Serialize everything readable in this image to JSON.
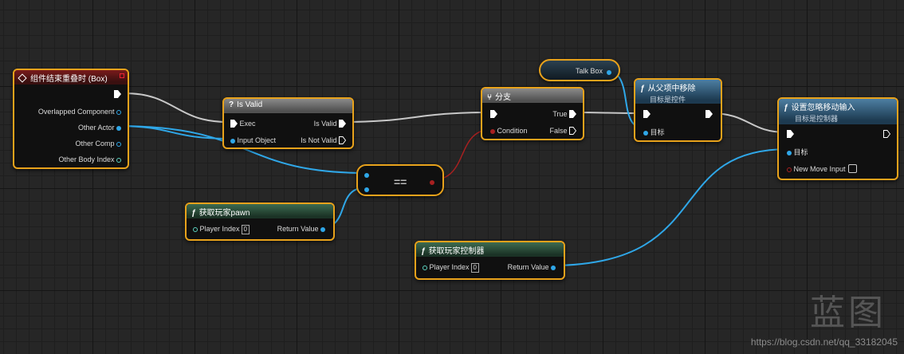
{
  "nodes": {
    "overlap_event": {
      "title": "组件结束重叠时 (Box)",
      "pins": [
        "Overlapped Component",
        "Other Actor",
        "Other Comp",
        "Other Body Index"
      ]
    },
    "is_valid": {
      "title": "Is Valid",
      "exec_in": "Exec",
      "input_object": "Input Object",
      "is_valid_out": "Is Valid",
      "is_not_valid_out": "Is Not Valid"
    },
    "equals": {
      "label": "=="
    },
    "get_player_pawn": {
      "title": "获取玩家pawn",
      "player_index_label": "Player Index",
      "player_index_value": "0",
      "return_value": "Return Value"
    },
    "branch": {
      "title": "分支",
      "condition": "Condition",
      "true_out": "True",
      "false_out": "False"
    },
    "talk_box": {
      "label": "Talk Box"
    },
    "remove_from_parent": {
      "title": "从父项中移除",
      "subtitle": "目标是控件",
      "target": "目标"
    },
    "get_player_controller": {
      "title": "获取玩家控制器",
      "player_index_label": "Player Index",
      "player_index_value": "0",
      "return_value": "Return Value"
    },
    "set_ignore_move_input": {
      "title": "设置忽略移动输入",
      "subtitle": "目标是控制器",
      "target": "目标",
      "new_move_input": "New Move Input"
    }
  },
  "watermark": {
    "big": "蓝图",
    "url": "https://blog.csdn.net/qq_33182045"
  },
  "colors": {
    "node_border": "#e8a21b",
    "exec_wire": "#c8c8c8",
    "object_wire": "#2fa7e8",
    "bool_wire": "#a82020"
  }
}
